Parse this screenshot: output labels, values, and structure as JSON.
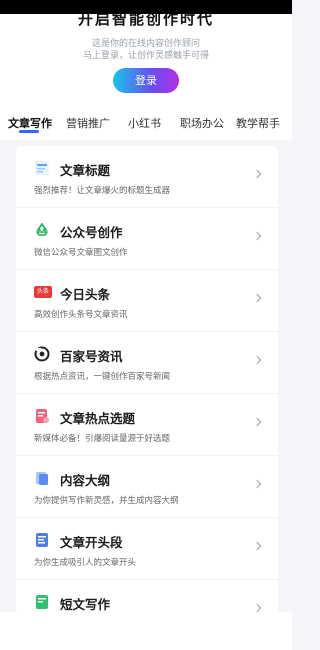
{
  "header": {
    "title_partial": "开启智能创作时代",
    "subtitle_line1": "这是你的在线内容创作顾问",
    "subtitle_line2": "马上登录，让创作灵感触手可得",
    "login_label": "登录"
  },
  "tabs": [
    {
      "label": "文章写作",
      "active": true
    },
    {
      "label": "营销推广",
      "active": false
    },
    {
      "label": "小红书",
      "active": false
    },
    {
      "label": "职场办公",
      "active": false
    },
    {
      "label": "教学帮手",
      "active": false
    }
  ],
  "tools": [
    {
      "name": "文章标题",
      "desc": "强烈推荐！让文章爆火的标题生成器",
      "icon": "title-doc-icon",
      "icon_color": "#5aa8f0",
      "icon_text": "Title"
    },
    {
      "name": "公众号创作",
      "desc": "微信公众号文章图文创作",
      "icon": "recycle-icon",
      "icon_color": "#22b35e",
      "icon_text": ""
    },
    {
      "name": "今日头条",
      "desc": "高效创作头条号文章资讯",
      "icon": "toutiao-icon",
      "icon_color": "#e43c3c",
      "icon_text": "头条"
    },
    {
      "name": "百家号资讯",
      "desc": "根据热点资讯，一键创作百家号新闻",
      "icon": "baijiahao-icon",
      "icon_color": "#222222",
      "icon_text": ""
    },
    {
      "name": "文章热点选题",
      "desc": "新媒体必备！引爆阅读量源于好选题",
      "icon": "hot-topic-icon",
      "icon_color": "#f2637e",
      "icon_text": ""
    },
    {
      "name": "内容大纲",
      "desc": "为你提供写作新灵感，并生成内容大纲",
      "icon": "outline-icon",
      "icon_color": "#5a8df0",
      "icon_text": ""
    },
    {
      "name": "文章开头段",
      "desc": "为你生成吸引人的文章开头",
      "icon": "opening-icon",
      "icon_color": "#4a7ee8",
      "icon_text": ""
    },
    {
      "name": "短文写作",
      "desc": "",
      "icon": "short-writing-icon",
      "icon_color": "#2fbf71",
      "icon_text": ""
    }
  ]
}
